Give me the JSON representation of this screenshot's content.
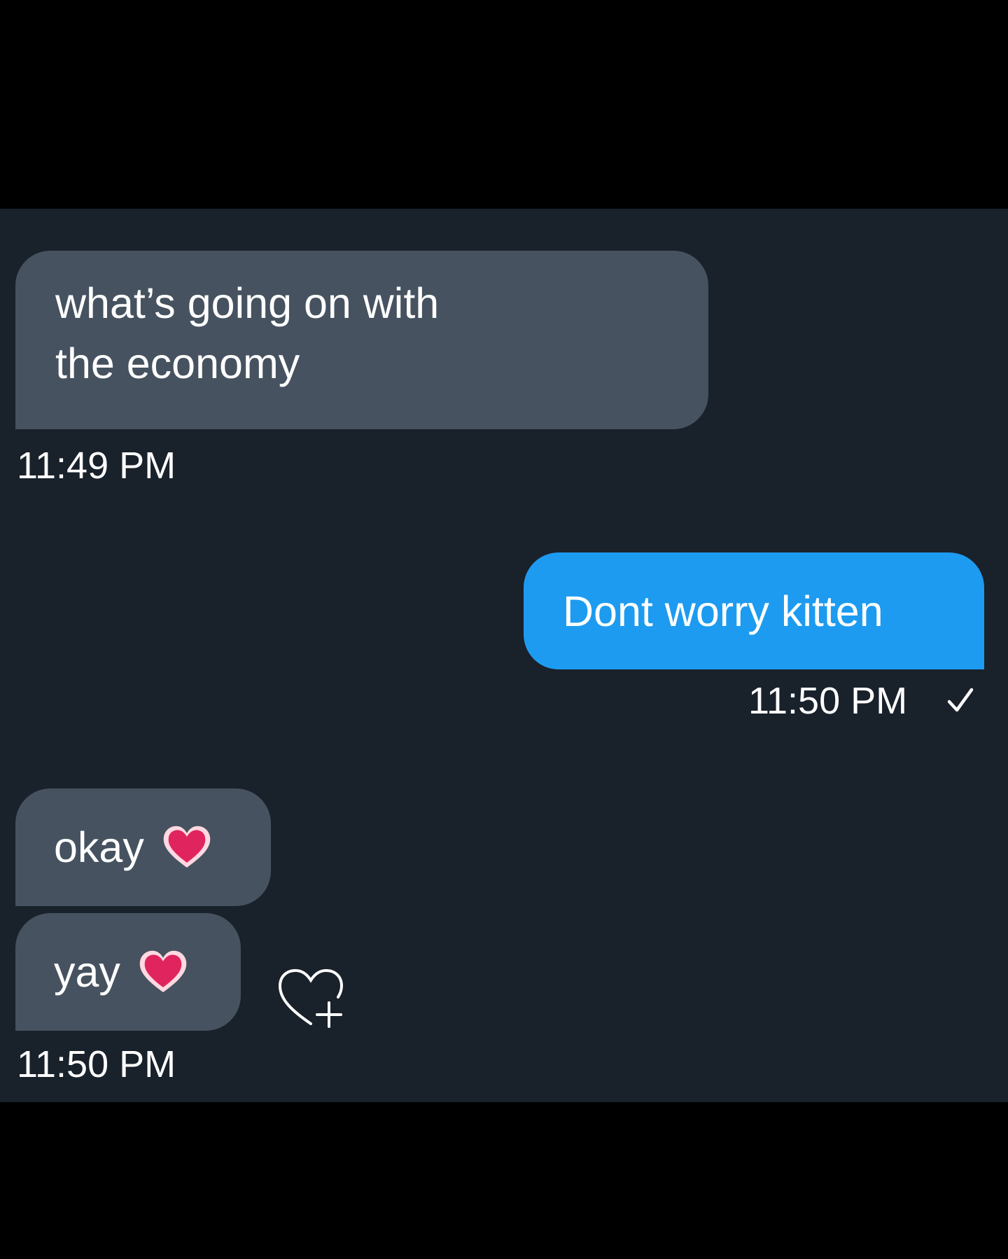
{
  "conversation": {
    "messages": [
      {
        "direction": "incoming",
        "lines": [
          "what’s going on with",
          "the economy"
        ]
      },
      {
        "direction": "outgoing",
        "text": "Dont worry kitten"
      },
      {
        "direction": "incoming",
        "text": "okay",
        "emoji": "heart-emoji"
      },
      {
        "direction": "incoming",
        "text": "yay",
        "emoji": "heart-emoji"
      }
    ],
    "timestamps": {
      "first": "11:49 PM",
      "sent": "11:50 PM",
      "last": "11:50 PM"
    },
    "sent_status_icon": "checkmark-icon",
    "reaction_icon": "heart-plus-icon"
  },
  "colors": {
    "background": "#19212b",
    "incoming_bubble": "#46525f",
    "outgoing_bubble": "#1d9bf0",
    "text": "#ffffff",
    "heart": "#e0245e"
  }
}
